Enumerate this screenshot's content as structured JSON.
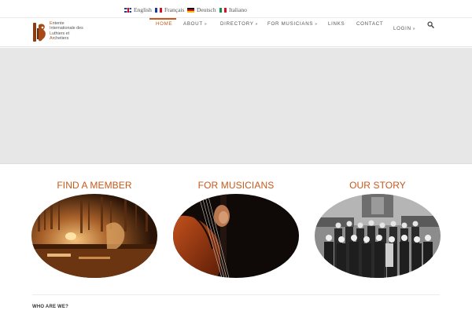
{
  "languages": [
    {
      "label": "English",
      "flag": "uk-flag-icon"
    },
    {
      "label": "Français",
      "flag": "france-flag-icon"
    },
    {
      "label": "Deutsch",
      "flag": "germany-flag-icon"
    },
    {
      "label": "Italiano",
      "flag": "italy-flag-icon"
    }
  ],
  "logo": {
    "lines": [
      {
        "initial": "E",
        "rest": "ntente"
      },
      {
        "initial": "I",
        "rest": "nternationale des"
      },
      {
        "initial": "L",
        "rest": "uthiers et"
      },
      {
        "initial": "A",
        "rest": "rchetiers"
      }
    ],
    "icon": "violin-logo-icon"
  },
  "nav": {
    "items": [
      {
        "label": "HOME",
        "dropdown": false,
        "active": true
      },
      {
        "label": "ABOUT",
        "dropdown": true
      },
      {
        "label": "DIRECTORY",
        "dropdown": true
      },
      {
        "label": "FOR MUSICIANS",
        "dropdown": true
      },
      {
        "label": "LINKS",
        "dropdown": false
      },
      {
        "label": "CONTACT",
        "dropdown": false
      },
      {
        "label": "LOGIN",
        "dropdown": true
      }
    ],
    "chevron": "»",
    "search_icon": "search-icon"
  },
  "features": [
    {
      "title": "FIND A MEMBER",
      "image": "luthier-workshop-photo"
    },
    {
      "title": "FOR MUSICIANS",
      "image": "cello-player-photo"
    },
    {
      "title": "OUR STORY",
      "image": "group-historic-photo"
    }
  ],
  "section": {
    "who_are_we": "WHO ARE WE?"
  },
  "colors": {
    "accent": "#c55a1d",
    "hero_bg": "#e7e7e7"
  }
}
